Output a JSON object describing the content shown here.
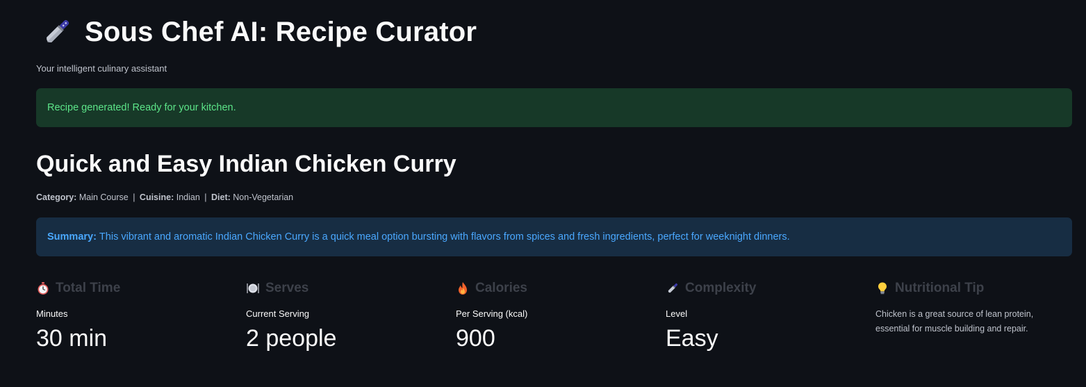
{
  "header": {
    "title": "Sous Chef AI: Recipe Curator",
    "title_icon": "kitchen-knife-icon",
    "subtitle": "Your intelligent culinary assistant"
  },
  "status": {
    "message": "Recipe generated! Ready for your kitchen."
  },
  "recipe": {
    "title": "Quick and Easy Indian Chicken Curry",
    "meta": {
      "category_key": "Category:",
      "category": "Main Course",
      "cuisine_key": "Cuisine:",
      "cuisine": "Indian",
      "diet_key": "Diet:",
      "diet": "Non-Vegetarian",
      "separator": "|"
    },
    "summary": {
      "key": "Summary:",
      "text": "This vibrant and aromatic Indian Chicken Curry is a quick meal option bursting with flavors from spices and fresh ingredients, perfect for weeknight dinners."
    }
  },
  "metrics": {
    "total_time": {
      "icon": "stopwatch-icon",
      "heading": "Total Time",
      "label": "Minutes",
      "value": "30 min"
    },
    "serves": {
      "icon": "plate-icon",
      "heading": "Serves",
      "label": "Current Serving",
      "value": "2 people"
    },
    "calories": {
      "icon": "fire-icon",
      "heading": "Calories",
      "label": "Per Serving (kcal)",
      "value": "900"
    },
    "complexity": {
      "icon": "kitchen-knife-icon",
      "heading": "Complexity",
      "label": "Level",
      "value": "Easy"
    },
    "tip": {
      "icon": "lightbulb-icon",
      "heading": "Nutritional Tip",
      "text": "Chicken is a great source of lean protein, essential for muscle building and repair."
    }
  },
  "colors": {
    "background": "#0e1117",
    "success_bg": "#173928",
    "success_text": "#5ce488",
    "info_bg": "#172d43",
    "info_text": "#4aa8ff"
  }
}
